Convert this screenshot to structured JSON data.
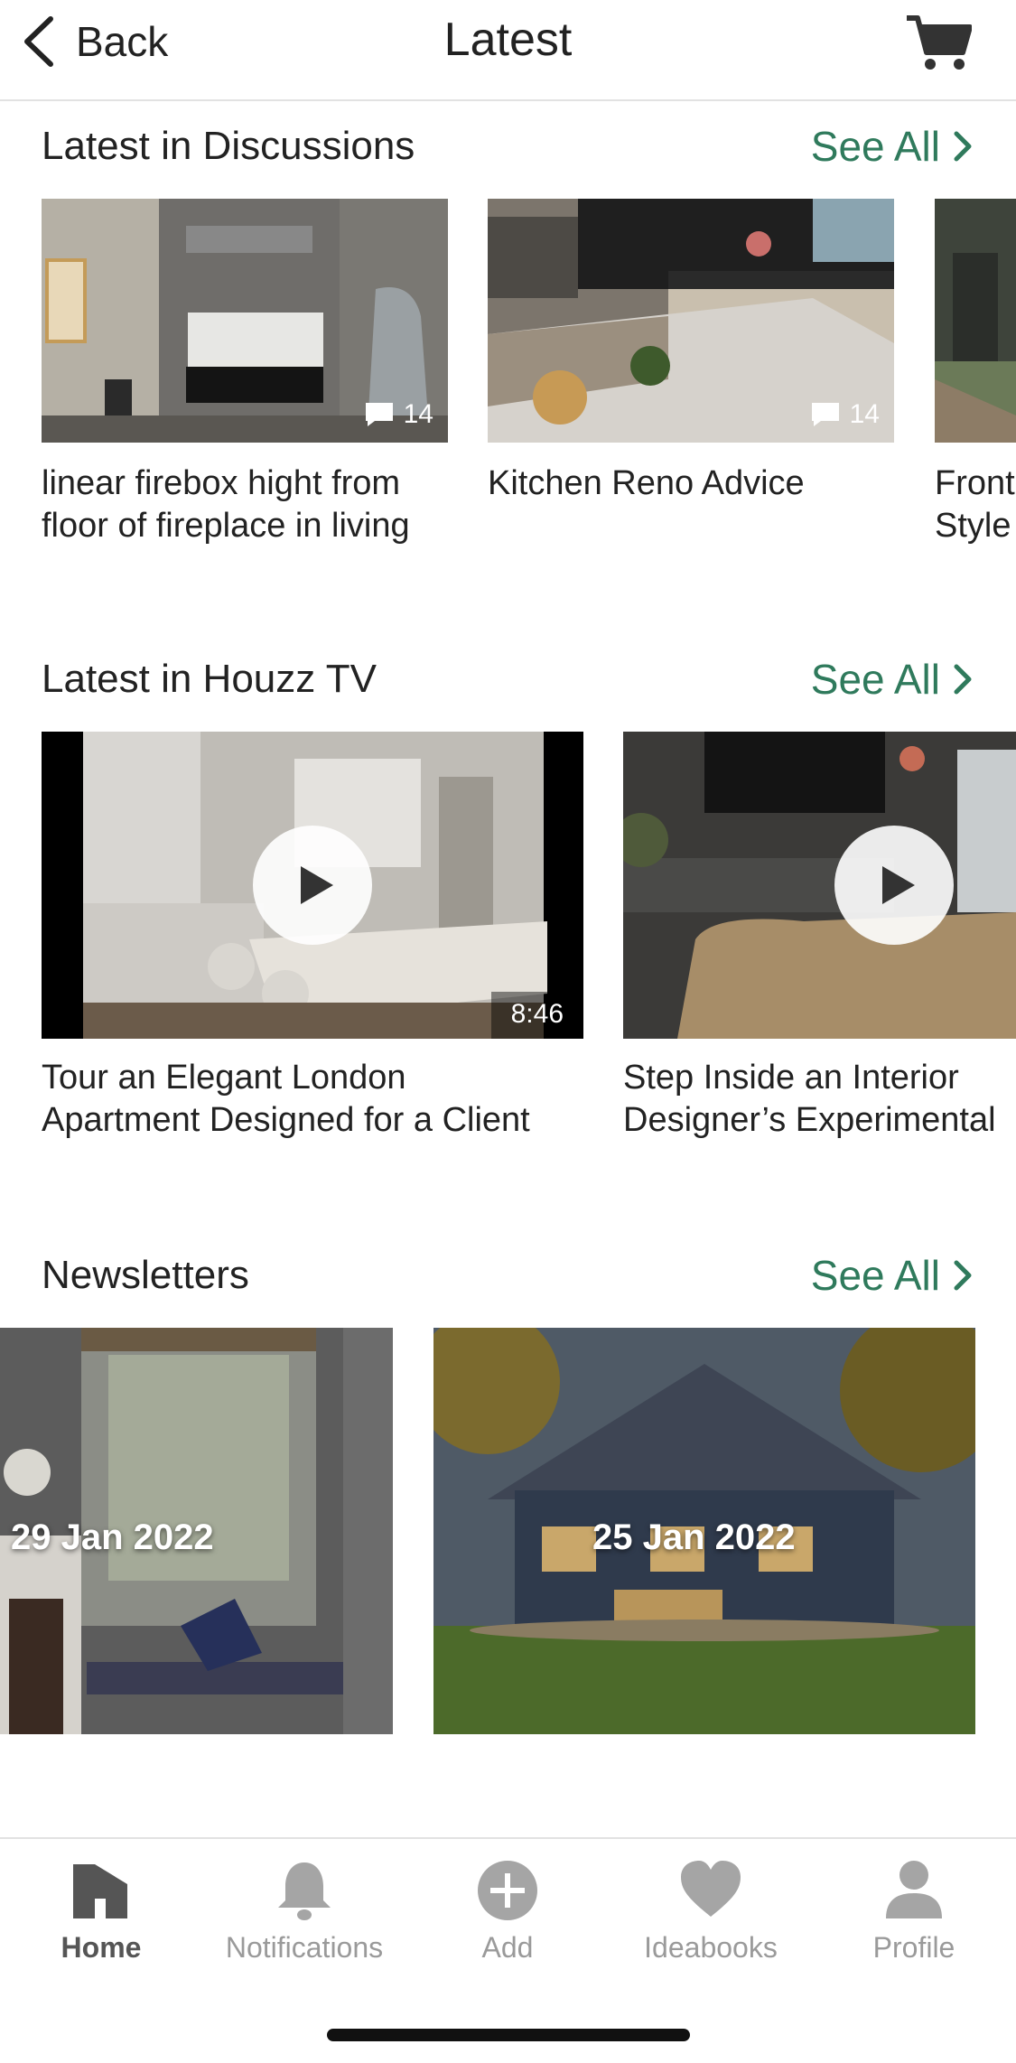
{
  "header": {
    "back_label": "Back",
    "title": "Latest",
    "cart_icon": "cart-icon"
  },
  "discussions": {
    "title": "Latest in Discussions",
    "see_all": "See All",
    "items": [
      {
        "caption_line1": "linear firebox hight from",
        "caption_line2": "floor of fireplace in living",
        "comments": "14"
      },
      {
        "caption_line1": "Kitchen Reno Advice",
        "caption_line2": "",
        "comments": "14"
      },
      {
        "caption_line1": "Front",
        "caption_line2": "Style",
        "comments": ""
      }
    ]
  },
  "houzz_tv": {
    "title": "Latest in Houzz TV",
    "see_all": "See All",
    "items": [
      {
        "caption_line1": "Tour an Elegant London",
        "caption_line2": "Apartment Designed for a Client",
        "duration": "8:46"
      },
      {
        "caption_line1": "Step Inside an Interior",
        "caption_line2": "Designer’s Experimental",
        "duration": ""
      }
    ]
  },
  "newsletters": {
    "title": "Newsletters",
    "see_all": "See All",
    "items": [
      {
        "date": "29 Jan 2022"
      },
      {
        "date": "25 Jan 2022"
      }
    ]
  },
  "bottom_nav": {
    "active": "Home",
    "items": [
      {
        "label": "Home",
        "icon": "home-icon"
      },
      {
        "label": "Notifications",
        "icon": "bell-icon"
      },
      {
        "label": "Add",
        "icon": "plus-circle-icon"
      },
      {
        "label": "Ideabooks",
        "icon": "heart-icon"
      },
      {
        "label": "Profile",
        "icon": "person-icon"
      }
    ]
  },
  "colors": {
    "accent": "#2f7a5c",
    "text": "#222222",
    "nav_inactive": "#9a9a9a"
  }
}
